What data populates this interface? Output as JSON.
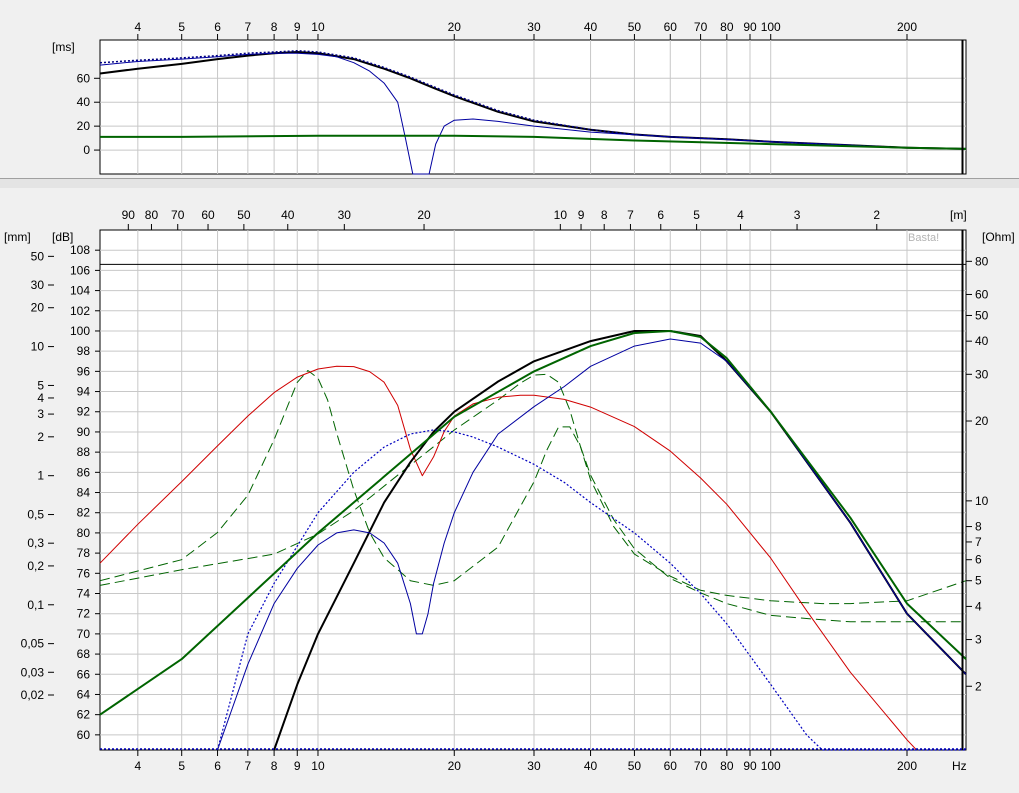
{
  "chart_data": [
    {
      "type": "line",
      "panel": "group-delay",
      "x_scale": "log",
      "xlim": [
        3.3,
        270
      ],
      "ylim": [
        -20,
        92
      ],
      "y_unit": "[ms]",
      "x_ticks": [
        4,
        5,
        6,
        7,
        8,
        9,
        10,
        20,
        30,
        40,
        50,
        60,
        70,
        80,
        90,
        100,
        200
      ],
      "x_tick_labels": [
        "4",
        "5",
        "6",
        "7",
        "8",
        "9",
        "10",
        "20",
        "30",
        "40",
        "50",
        "60",
        "70",
        "80",
        "90",
        "100",
        "200"
      ],
      "y_ticks": [
        0,
        20,
        40,
        60
      ],
      "series": [
        {
          "color": "#000000",
          "style": "solid",
          "width": 2,
          "x": [
            3.3,
            4,
            5,
            6,
            7,
            8,
            9,
            10,
            12,
            14,
            16,
            18,
            20,
            25,
            30,
            40,
            50,
            60,
            80,
            100,
            150,
            200,
            270
          ],
          "y": [
            64,
            68,
            72,
            76,
            79,
            81,
            82,
            81,
            76,
            68,
            60,
            52,
            45,
            32,
            24,
            17,
            13,
            11,
            9,
            7,
            4,
            2,
            1
          ]
        },
        {
          "color": "#000080",
          "style": "dotted",
          "width": 1.5,
          "x": [
            3.3,
            4,
            5,
            6,
            7,
            8,
            9,
            10,
            12,
            14,
            16,
            18,
            20,
            25,
            30,
            40,
            50,
            60,
            80,
            100,
            150,
            200,
            270
          ],
          "y": [
            73,
            75,
            77,
            79,
            81,
            82,
            83,
            82,
            77,
            69,
            61,
            53,
            46,
            33,
            25,
            17,
            13,
            11,
            9,
            7,
            4,
            2,
            1
          ]
        },
        {
          "color": "#0000a0",
          "style": "solid",
          "width": 1,
          "x": [
            3.3,
            4,
            5,
            6,
            7,
            8,
            9,
            10,
            11,
            12,
            13,
            14,
            15,
            15.6,
            16.2,
            17,
            17.6,
            18.2,
            19,
            20,
            22,
            25,
            30,
            40,
            60,
            100,
            200
          ],
          "y": [
            71,
            74,
            76,
            78,
            80,
            81,
            81,
            80,
            78,
            73,
            66,
            56,
            40,
            10,
            -20,
            -20,
            -20,
            5,
            20,
            25,
            26,
            24,
            20,
            15,
            11,
            7,
            2
          ]
        },
        {
          "color": "#006400",
          "style": "solid",
          "width": 2,
          "x": [
            3.3,
            5,
            10,
            20,
            30,
            50,
            100,
            200,
            270
          ],
          "y": [
            11,
            11,
            12,
            12,
            11,
            8,
            5,
            2,
            1
          ]
        }
      ]
    },
    {
      "type": "line",
      "panel": "frequency-response",
      "x_scale": "log",
      "xlim": [
        3.3,
        270
      ],
      "ylim": [
        58.5,
        110
      ],
      "y_unit": "[dB]",
      "y_left_unit": "[mm]",
      "y_right_unit": "[Ohm]",
      "top_unit": "[m]",
      "x_end_label": "Hz",
      "watermark": "Basta!",
      "reference_line_db": 106.6,
      "x_ticks": [
        4,
        5,
        6,
        7,
        8,
        9,
        10,
        20,
        30,
        40,
        50,
        60,
        70,
        80,
        90,
        100,
        200
      ],
      "x_tick_labels": [
        "4",
        "5",
        "6",
        "7",
        "8",
        "9",
        "10",
        "20",
        "30",
        "40",
        "50",
        "60",
        "70",
        "80",
        "90",
        "100",
        "200"
      ],
      "db_ticks": [
        60,
        62,
        64,
        66,
        68,
        70,
        72,
        74,
        76,
        78,
        80,
        82,
        84,
        86,
        88,
        90,
        92,
        94,
        96,
        98,
        100,
        102,
        104,
        106,
        108
      ],
      "mm_ticks": [
        50,
        30,
        20,
        10,
        5,
        4,
        3,
        2,
        1,
        0.5,
        0.3,
        0.2,
        0.1,
        0.05,
        0.03,
        0.02
      ],
      "mm_tick_labels": [
        "50",
        "30",
        "20",
        "10",
        "5",
        "4",
        "3",
        "2",
        "1",
        "0,5",
        "0,3",
        "0,2",
        "0,1",
        "0,05",
        "0,03",
        "0,02"
      ],
      "mm_range": [
        0.0075,
        80
      ],
      "ohm_ticks": [
        80,
        60,
        50,
        40,
        30,
        20,
        10,
        8,
        7,
        6,
        5,
        4,
        3,
        2
      ],
      "ohm_tick_labels": [
        "80",
        "60",
        "50",
        "40",
        "30",
        "20",
        "10",
        "8",
        "7",
        "6",
        "5",
        "4",
        "3",
        "2"
      ],
      "ohm_range": [
        1.15,
        105
      ],
      "wavelength_ticks": [
        90,
        80,
        70,
        60,
        50,
        40,
        30,
        20,
        10,
        9,
        8,
        7,
        6,
        5,
        4,
        3,
        2
      ],
      "wavelength_labels": [
        "90",
        "80",
        "70",
        "60",
        "50",
        "40",
        "30",
        "20",
        "10",
        "9",
        "8",
        "7",
        "6",
        "5",
        "4",
        "3",
        "2"
      ],
      "series": [
        {
          "color": "#000000",
          "style": "solid",
          "width": 2,
          "x": [
            8,
            9,
            10,
            12,
            14,
            16,
            18,
            20,
            25,
            30,
            40,
            50,
            60,
            70,
            80,
            100,
            150,
            200,
            270
          ],
          "y": [
            58.5,
            65,
            70,
            77,
            83,
            87,
            90,
            92,
            95,
            97,
            99,
            100,
            100,
            99.5,
            97,
            92,
            81,
            72,
            66
          ]
        },
        {
          "color": "#0000c0",
          "style": "dotted",
          "width": 1.2,
          "x": [
            6,
            7,
            8,
            10,
            12,
            14,
            16,
            18,
            20,
            22,
            25,
            30,
            35,
            40,
            50,
            60,
            70,
            80,
            100,
            120,
            130,
            150,
            200,
            270
          ],
          "y": [
            58.5,
            70,
            75,
            82,
            86,
            88.5,
            89.8,
            90.2,
            90,
            89.5,
            88.5,
            86.8,
            85,
            83,
            80,
            77,
            74,
            71,
            65,
            60,
            58.5,
            58.5,
            58.5,
            58.5
          ]
        },
        {
          "color": "#0000a0",
          "style": "solid",
          "width": 1,
          "x": [
            6,
            7,
            8,
            9,
            10,
            11,
            12,
            13,
            14,
            15,
            16,
            16.5,
            17,
            17.5,
            18,
            19,
            20,
            22,
            25,
            30,
            35,
            40,
            50,
            60,
            70,
            80,
            100,
            150,
            200,
            270
          ],
          "y": [
            58.5,
            67,
            73,
            76.5,
            78.8,
            80,
            80.3,
            80,
            79,
            77,
            73,
            70,
            70,
            72,
            75,
            79,
            82,
            86,
            89.8,
            92.5,
            94.5,
            96.5,
            98.5,
            99.2,
            98.8,
            97,
            92,
            81,
            72,
            66
          ]
        },
        {
          "color": "#006400",
          "style": "solid",
          "width": 2,
          "x": [
            3.3,
            5,
            10,
            20,
            30,
            40,
            50,
            60,
            70,
            80,
            100,
            150,
            200,
            270
          ],
          "y": [
            62,
            67.5,
            80,
            91.5,
            96,
            98.5,
            99.8,
            100,
            99.4,
            97.3,
            92,
            81.5,
            73,
            67.5
          ]
        }
      ],
      "mm_series": [
        {
          "color": "#d00000",
          "style": "solid",
          "width": 1,
          "x": [
            3.3,
            4,
            5,
            6,
            7,
            8,
            9,
            10,
            11,
            12,
            13,
            14,
            15,
            16,
            17,
            18,
            19,
            20,
            22,
            25,
            28,
            30,
            35,
            40,
            50,
            60,
            70,
            80,
            100,
            120,
            150,
            200,
            210
          ],
          "y": [
            0.21,
            0.42,
            0.9,
            1.7,
            2.9,
            4.4,
            5.8,
            6.7,
            7.05,
            7,
            6.4,
            5.3,
            3.5,
            1.6,
            1.0,
            1.4,
            2.2,
            2.9,
            3.6,
            4.05,
            4.2,
            4.2,
            3.9,
            3.4,
            2.4,
            1.55,
            0.96,
            0.6,
            0.23,
            0.09,
            0.03,
            0.009,
            0.0075
          ]
        }
      ],
      "ohm_series": [
        {
          "color": "#006400",
          "style": "dashed",
          "width": 1,
          "x": [
            3.3,
            5,
            6,
            7,
            8,
            8.5,
            9,
            9.5,
            10,
            10.5,
            11,
            12,
            13,
            14,
            16,
            18,
            20,
            25,
            30,
            32,
            34,
            36,
            38,
            40,
            45,
            50,
            60,
            70,
            80,
            100,
            120,
            150,
            200,
            270
          ],
          "y": [
            5,
            6,
            7.6,
            10.5,
            17,
            22,
            28,
            31,
            29,
            24,
            18,
            11,
            7.6,
            6.1,
            5,
            4.8,
            5,
            6.7,
            11.8,
            15.5,
            19,
            19,
            16,
            12.5,
            8.5,
            6.6,
            5.1,
            4.5,
            4.1,
            3.7,
            3.6,
            3.5,
            3.5,
            3.5
          ]
        },
        {
          "color": "#006400",
          "style": "dashed",
          "width": 1,
          "x": [
            3.3,
            5,
            8,
            10,
            12,
            15,
            18,
            20,
            25,
            28,
            30,
            32,
            34,
            36,
            38,
            40,
            45,
            50,
            60,
            70,
            80,
            100,
            130,
            150,
            200,
            270
          ],
          "y": [
            4.8,
            5.5,
            6.3,
            7.5,
            9.2,
            12.5,
            16,
            18.5,
            24,
            27.8,
            29.8,
            30,
            28,
            22,
            16,
            12,
            8,
            6.3,
            5.2,
            4.6,
            4.4,
            4.2,
            4.1,
            4.1,
            4.2,
            5
          ]
        }
      ]
    }
  ]
}
